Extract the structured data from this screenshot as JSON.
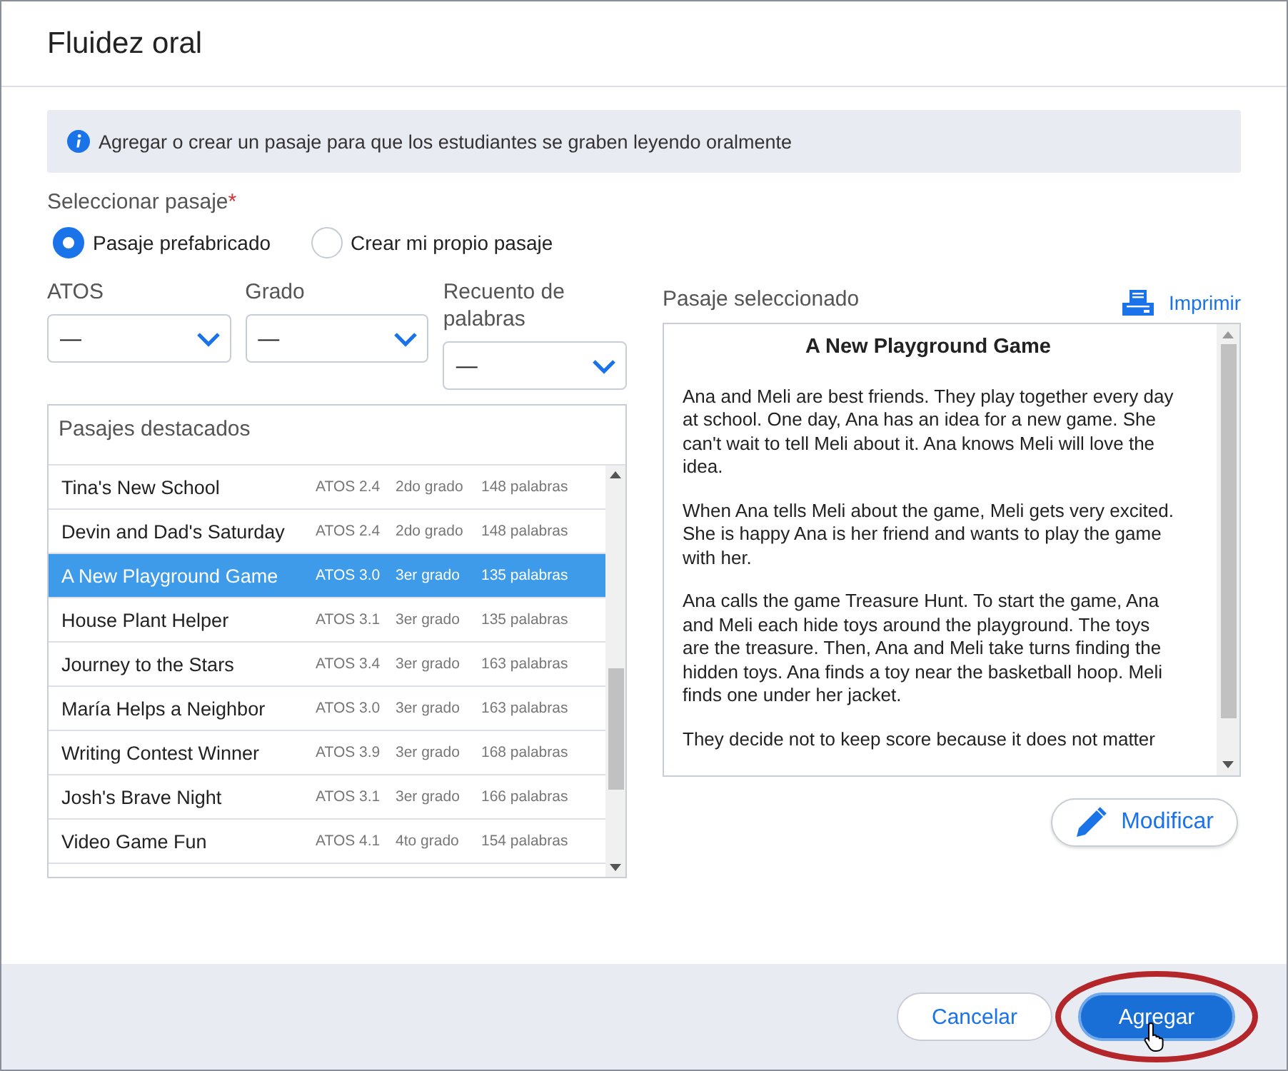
{
  "dialog": {
    "title": "Fluidez oral"
  },
  "info_banner": "Agregar o crear un pasaje para que los estudiantes se graben leyendo oralmente",
  "passage_source": {
    "label": "Seleccionar pasaje",
    "required_mark": "*",
    "options": [
      {
        "label": "Pasaje prefabricado",
        "selected": true
      },
      {
        "label": "Crear mi propio pasaje",
        "selected": false
      }
    ]
  },
  "filters": [
    {
      "label": "ATOS",
      "value": "—"
    },
    {
      "label": "Grado",
      "value": "—"
    },
    {
      "label": "Recuento de palabras",
      "value": "—"
    }
  ],
  "featured_passages": {
    "title": "Pasajes destacados",
    "rows": [
      {
        "title": "Tina's New School",
        "atos": "ATOS 2.4",
        "grade": "2do grado",
        "words": "148 palabras",
        "selected": false
      },
      {
        "title": "Devin and Dad's Saturday",
        "atos": "ATOS 2.4",
        "grade": "2do grado",
        "words": "148 palabras",
        "selected": false
      },
      {
        "title": "A New Playground Game",
        "atos": "ATOS 3.0",
        "grade": "3er grado",
        "words": "135 palabras",
        "selected": true
      },
      {
        "title": "House Plant Helper",
        "atos": "ATOS 3.1",
        "grade": "3er grado",
        "words": "135 palabras",
        "selected": false
      },
      {
        "title": "Journey to the Stars",
        "atos": "ATOS 3.4",
        "grade": "3er grado",
        "words": "163 palabras",
        "selected": false
      },
      {
        "title": "María Helps a Neighbor",
        "atos": "ATOS 3.0",
        "grade": "3er grado",
        "words": "163 palabras",
        "selected": false
      },
      {
        "title": "Writing Contest Winner",
        "atos": "ATOS 3.9",
        "grade": "3er grado",
        "words": "168 palabras",
        "selected": false
      },
      {
        "title": "Josh's Brave Night",
        "atos": "ATOS 3.1",
        "grade": "3er grado",
        "words": "166 palabras",
        "selected": false
      },
      {
        "title": "Video Game Fun",
        "atos": "ATOS 4.1",
        "grade": "4to grado",
        "words": "154 palabras",
        "selected": false
      }
    ]
  },
  "selected_passage": {
    "label": "Pasaje seleccionado",
    "print_link": "Imprimir",
    "title": "A New Playground Game",
    "paragraphs": [
      "Ana and Meli are best friends. They play together every day at school. One day, Ana has an idea for a new game. She can't wait to tell Meli about it. Ana knows Meli will love the idea.",
      "When Ana tells Meli about the game, Meli gets very excited.  She is happy Ana is her friend and wants to play the game with her.",
      "Ana calls the game Treasure Hunt. To start the game, Ana and Meli each hide toys around the playground. The toys are the treasure. Then, Ana and Meli take turns finding the hidden toys. Ana finds a toy near the basketball hoop. Meli finds one under her jacket.",
      "They decide not to keep score because it does not matter"
    ],
    "edit_button": "Modificar"
  },
  "footer": {
    "buttons": [
      {
        "label": "Cancelar",
        "kind": "secondary"
      },
      {
        "label": "Agregar",
        "kind": "primary"
      }
    ]
  }
}
